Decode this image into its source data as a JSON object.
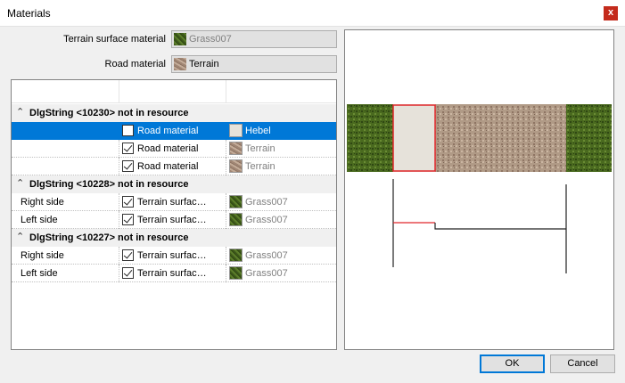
{
  "window": {
    "title": "Materials",
    "close": "x"
  },
  "top_fields": [
    {
      "label": "Terrain surface material",
      "value": "Grass007",
      "swatch": "grass",
      "disabled": true
    },
    {
      "label": "Road material",
      "value": "Terrain",
      "swatch": "terrain",
      "disabled": false
    }
  ],
  "groups": [
    {
      "title": "DlgString <10230> not in resource",
      "rows": [
        {
          "label": "",
          "checked": false,
          "type": "Road material",
          "material": "Hebel",
          "swatch": "hebel",
          "selected": true
        },
        {
          "label": "",
          "checked": true,
          "type": "Road material",
          "material": "Terrain",
          "swatch": "terrain",
          "selected": false
        },
        {
          "label": "",
          "checked": true,
          "type": "Road material",
          "material": "Terrain",
          "swatch": "terrain",
          "selected": false
        }
      ]
    },
    {
      "title": "DlgString <10228> not in resource",
      "rows": [
        {
          "label": "Right side",
          "checked": true,
          "type": "Terrain surfac…",
          "material": "Grass007",
          "swatch": "grass",
          "selected": false
        },
        {
          "label": "Left side",
          "checked": true,
          "type": "Terrain surfac…",
          "material": "Grass007",
          "swatch": "grass",
          "selected": false
        }
      ]
    },
    {
      "title": "DlgString <10227> not in resource",
      "rows": [
        {
          "label": "Right side",
          "checked": true,
          "type": "Terrain surfac…",
          "material": "Grass007",
          "swatch": "grass",
          "selected": false
        },
        {
          "label": "Left side",
          "checked": true,
          "type": "Terrain surfac…",
          "material": "Grass007",
          "swatch": "grass",
          "selected": false
        }
      ]
    }
  ],
  "buttons": {
    "ok": "OK",
    "cancel": "Cancel"
  },
  "colors": {
    "selection": "#0078d7",
    "highlight_outline": "#e0262a",
    "profile_line": "#222222",
    "profile_highlight": "#e0262a"
  },
  "icons": {
    "group_toggle": "double-chevron-up-icon"
  }
}
